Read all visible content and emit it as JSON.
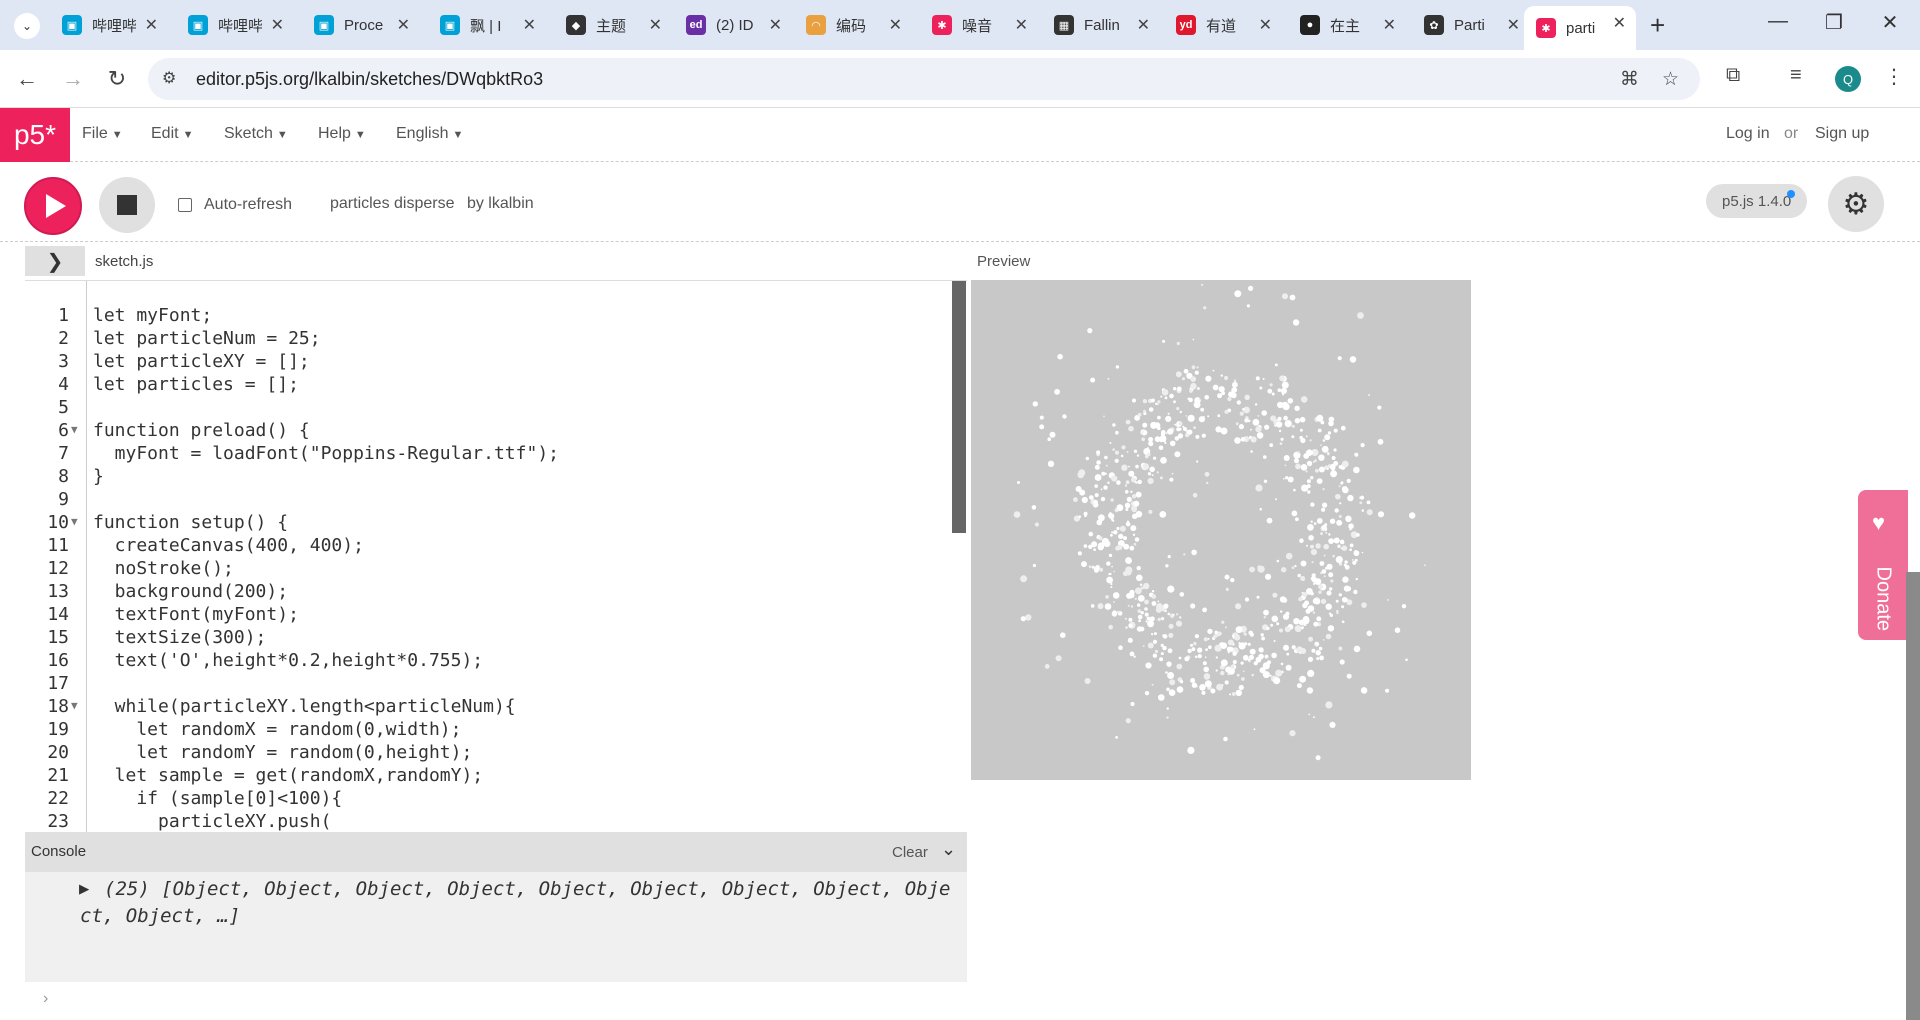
{
  "browser": {
    "tabs": [
      {
        "label": "哔哩哔",
        "fav_color": "#00a1d6",
        "fav_glyph": "tv-icon"
      },
      {
        "label": "哔哩哔",
        "fav_color": "#00a1d6",
        "fav_glyph": "tv-icon"
      },
      {
        "label": "Proce",
        "fav_color": "#00a1d6",
        "fav_glyph": "tv-icon"
      },
      {
        "label": "飘 | I",
        "fav_color": "#00a1d6",
        "fav_glyph": "tv-icon"
      },
      {
        "label": "主题",
        "fav_color": "#333333",
        "fav_glyph": "shield-icon"
      },
      {
        "label": "(2) ID",
        "fav_color": "#6b2fa5",
        "fav_glyph": "ed-icon"
      },
      {
        "label": "编码",
        "fav_color": "#e8a040",
        "fav_glyph": "rainbow-icon"
      },
      {
        "label": "噪音",
        "fav_color": "#ed225d",
        "fav_glyph": "asterisk-icon"
      },
      {
        "label": "Fallin",
        "fav_color": "#333333",
        "fav_glyph": "grid-icon"
      },
      {
        "label": "有道",
        "fav_color": "#e0182d",
        "fav_glyph": "yd-icon"
      },
      {
        "label": "在主",
        "fav_color": "#222222",
        "fav_glyph": "github-icon"
      },
      {
        "label": "Parti",
        "fav_color": "#333333",
        "fav_glyph": "openai-icon"
      },
      {
        "label": "parti",
        "fav_color": "#ed225d",
        "fav_glyph": "asterisk-icon"
      }
    ],
    "url": "editor.p5js.org/lkalbin/sketches/DWqbktRo3"
  },
  "p5": {
    "logo": "p5*",
    "menus": [
      "File",
      "Edit",
      "Sketch",
      "Help",
      "English"
    ],
    "login": "Log in",
    "or": "or",
    "signup": "Sign up",
    "auto_refresh": "Auto-refresh",
    "sketch_name": "particles disperse",
    "by": "by lkalbin",
    "version": "p5.js 1.4.0",
    "filename": "sketch.js",
    "preview_label": "Preview",
    "console_title": "Console",
    "console_clear": "Clear",
    "console_log_line1": "(25) [Object, Object, Object, Object, Object, Object, Object, Object, Obje",
    "console_log_line2": "ct, Object, …]",
    "donate": "Donate"
  },
  "code_lines": [
    "let myFont;",
    "let particleNum = 25;",
    "let particleXY = [];",
    "let particles = [];",
    "",
    "function preload() {",
    "  myFont = loadFont(\"Poppins-Regular.ttf\");",
    "}",
    "",
    "function setup() {",
    "  createCanvas(400, 400);",
    "  noStroke();",
    "  background(200);",
    "  textFont(myFont);",
    "  textSize(300);",
    "  text('O',height*0.2,height*0.755);",
    "",
    "  while(particleXY.length<particleNum){",
    "    let randomX = random(0,width);",
    "    let randomY = random(0,height);",
    "  let sample = get(randomX,randomY);",
    "    if (sample[0]<100){",
    "      particleXY.push("
  ],
  "colors": {
    "p5_pink": "#ed225d",
    "keyword": "#7a3e00",
    "variable": "#0b6fa4",
    "function": "#0b5aa4",
    "string": "#2e7d1a",
    "special": "#d4227a",
    "canvas_bg": "#c8c8c8"
  }
}
